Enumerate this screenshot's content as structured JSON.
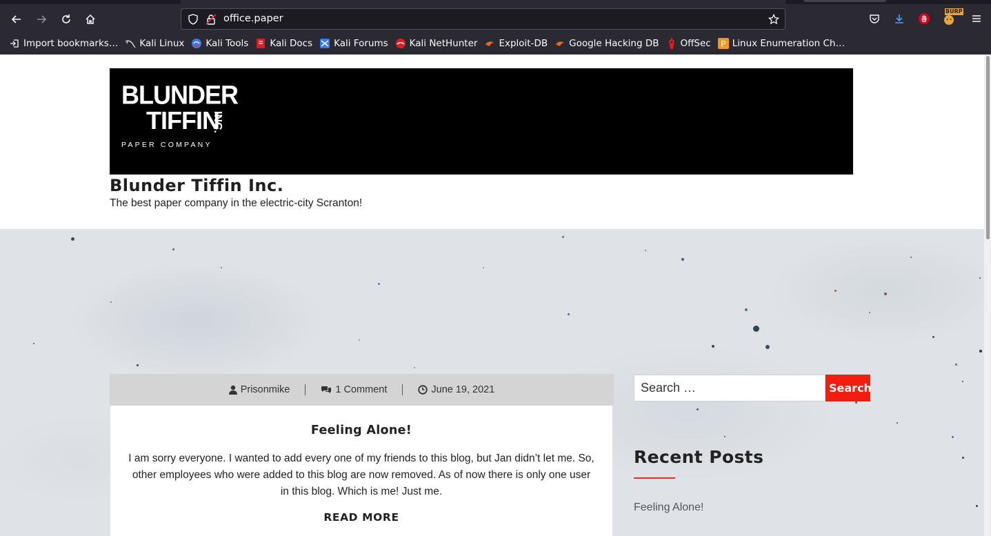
{
  "browser": {
    "url": "office.paper",
    "bookmarks": [
      {
        "label": "Import bookmarks…",
        "icon": "import-icon"
      },
      {
        "label": "Kali Linux",
        "icon": "kali-dragon-icon"
      },
      {
        "label": "Kali Tools",
        "icon": "kali-tools-icon"
      },
      {
        "label": "Kali Docs",
        "icon": "kali-docs-icon"
      },
      {
        "label": "Kali Forums",
        "icon": "kali-forums-icon"
      },
      {
        "label": "Kali NetHunter",
        "icon": "nethunter-icon"
      },
      {
        "label": "Exploit-DB",
        "icon": "exploit-db-icon"
      },
      {
        "label": "Google Hacking DB",
        "icon": "ghdb-icon"
      },
      {
        "label": "OffSec",
        "icon": "offsec-icon"
      },
      {
        "label": "Linux Enumeration Ch…",
        "icon": "linux-enum-icon"
      }
    ],
    "burp_badge": "BURP"
  },
  "site": {
    "logo": {
      "line1": "BLUNDER",
      "line2": "TIFFIN",
      "inc": "INC.",
      "line3": "PAPER COMPANY"
    },
    "title": "Blunder Tiffin Inc.",
    "description": "The best paper company in the electric-city Scranton!"
  },
  "post": {
    "author": "Prisonmike",
    "comments": "1 Comment",
    "date": "June 19, 2021",
    "title": "Feeling Alone!",
    "excerpt": "I am sorry everyone. I wanted to add every one of my friends to this blog, but Jan didn’t let me. So, other employees who were added to this blog are now removed. As of now there is only one user in this blog. Which is me! Just me.",
    "read_more": "READ MORE"
  },
  "sidebar": {
    "search_placeholder": "Search …",
    "search_button": "Search",
    "recent_posts_title": "Recent Posts",
    "recent_posts": [
      "Feeling Alone!"
    ]
  },
  "colors": {
    "chrome_bg": "#2b2a33",
    "accent_red": "#f41b0f",
    "meta_bar": "#d4d4d4"
  }
}
